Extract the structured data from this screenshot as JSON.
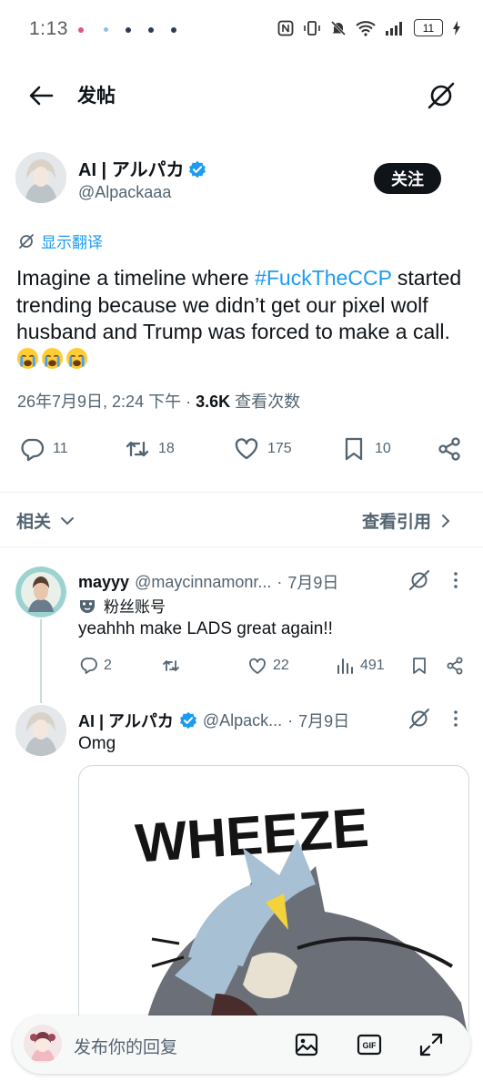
{
  "status_bar": {
    "time": "1:13",
    "battery": "11"
  },
  "header": {
    "title": "发帖",
    "back_icon": "back-arrow-icon",
    "grok_icon": "grok-icon"
  },
  "tweet": {
    "author": {
      "name": "AI | アルパカ",
      "handle": "@Alpackaaa",
      "verified": true
    },
    "follow_label": "关注",
    "translate_label": "显示翻译",
    "text_before": "Imagine a timeline where ",
    "hashtag": "#FuckTheCCP",
    "text_after": " started trending because we didn’t get our pixel wolf husband and Trump was forced to make a call.",
    "emoji_count": 3,
    "timestamp": "26年7月9日, 2:24 下午",
    "separator": "·",
    "views": "3.6K",
    "views_label": "查看次数",
    "stats": {
      "replies": "11",
      "reposts": "18",
      "likes": "175",
      "bookmarks": "10"
    }
  },
  "related_bar": {
    "related_label": "相关",
    "view_quotes_label": "查看引用"
  },
  "replies": [
    {
      "name": "mayyy",
      "handle": "@maycinnamonr...",
      "separator": "·",
      "date": "7月9日",
      "badge": "粉丝账号",
      "text": "yeahhh make LADS great again!!",
      "stats": {
        "replies": "2",
        "reposts": "",
        "likes": "22",
        "views": "491"
      }
    },
    {
      "name": "AI | アルパカ",
      "handle": "@Alpack...",
      "separator": "·",
      "date": "7月9日",
      "text": "Omg",
      "media_text": "WHEEZE"
    }
  ],
  "compose": {
    "placeholder": "发布你的回复"
  },
  "colors": {
    "accent": "#1d9bf0",
    "text": "#0f1419",
    "muted": "#536471"
  }
}
